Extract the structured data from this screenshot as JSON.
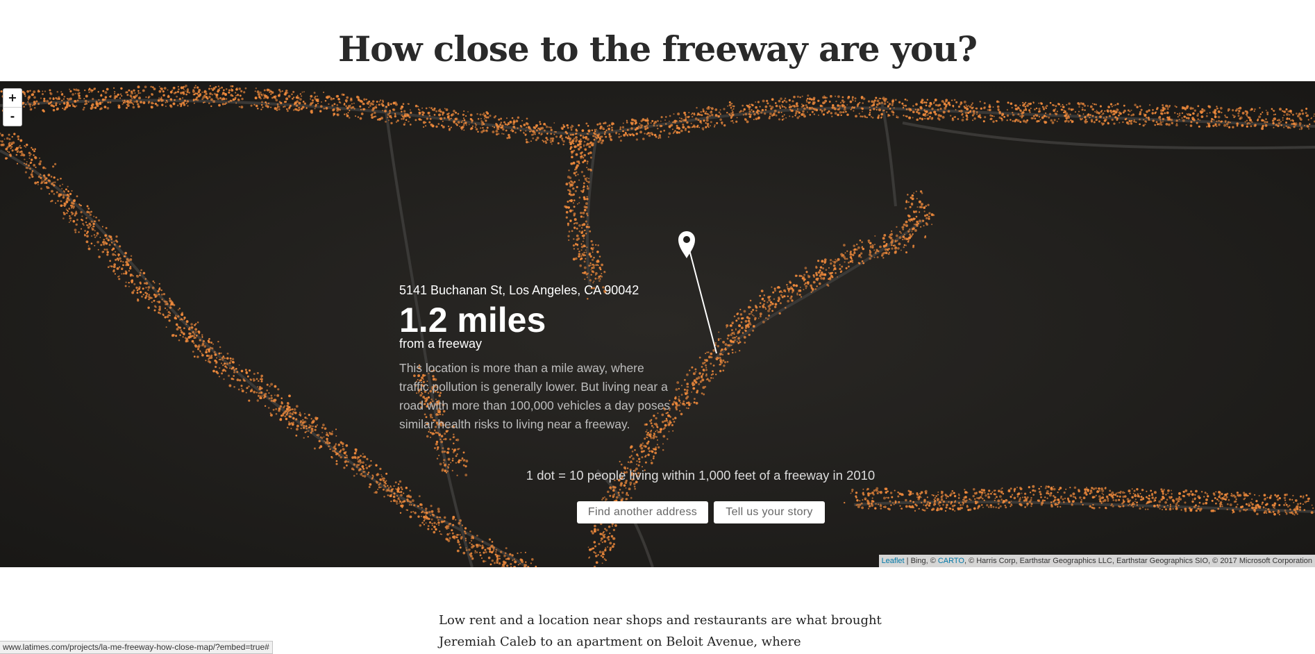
{
  "page": {
    "title": "How close to the freeway are you?"
  },
  "map": {
    "zoom_in_label": "+",
    "zoom_out_label": "-",
    "dot_color": "#ef8a3c",
    "background_color": "#1f1e1c",
    "marker_icon": "location-pin-icon"
  },
  "result": {
    "address": "5141 Buchanan St, Los Angeles, CA 90042",
    "distance": "1.2 miles",
    "distance_sub": "from a freeway",
    "description": "This location is more than a mile away, where traffic pollution is generally lower. But living near a road with more than 100,000 vehicles a day poses similar health risks to living near a freeway."
  },
  "legend": {
    "text": "1 dot = 10 people living within 1,000 feet of a freeway in 2010"
  },
  "buttons": {
    "find_address": "Find another address",
    "tell_story": "Tell us your story"
  },
  "attribution": {
    "leaflet": "Leaflet",
    "sep1": " | Bing, © ",
    "carto": "CARTO",
    "rest": ", © Harris Corp, Earthstar Geographics LLC, Earthstar Geographics SIO, © 2017 Microsoft Corporation"
  },
  "article": {
    "text": "Low rent and a location near shops and restaurants are what brought Jeremiah Caleb to an apartment on Beloit Avenue, where"
  },
  "status_bar": {
    "url": "www.latimes.com/projects/la-me-freeway-how-close-map/?embed=true#"
  }
}
